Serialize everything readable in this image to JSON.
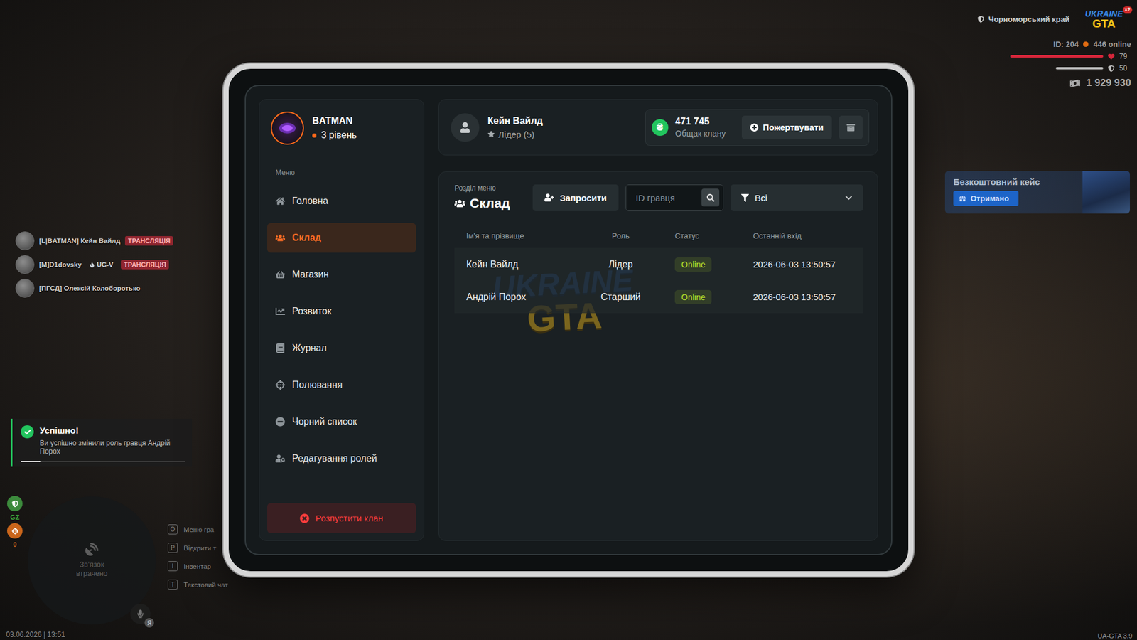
{
  "hud": {
    "region": "Чорноморський край",
    "logo": {
      "line1": "UKRAINE",
      "line2": "GTA",
      "badge": "x2"
    },
    "id": "ID: 204",
    "online": "446 online",
    "health": {
      "level": 1,
      "reading": "79"
    },
    "armor": {
      "level": 0.51,
      "reading": "50"
    },
    "money": "1 929 930"
  },
  "case_widget": {
    "title": "Безкоштовний кейс",
    "button": "Отримано"
  },
  "voice": [
    {
      "name": "[L|BATMAN] Кейн Вайлд",
      "tags": [
        {
          "text": "ТРАНСЛЯЦІЯ",
          "kind": "live"
        }
      ]
    },
    {
      "name": "[M]D1dovsky",
      "tags": [
        {
          "text": "UG-V",
          "kind": "org"
        },
        {
          "text": "ТРАНСЛЯЦІЯ",
          "kind": "live"
        }
      ]
    },
    {
      "name": "[ПГСД] Олексій Колоборотько",
      "tags": []
    }
  ],
  "notification": {
    "title": "Успішно!",
    "text": "Ви успішно змінили роль гравця Андрій Порох",
    "level": 0.12
  },
  "minimap": {
    "text": "Зв'язок втрачено",
    "zone": "GZ",
    "count": "0",
    "mic_badge": "Я"
  },
  "keys": [
    {
      "key": "O",
      "label": "Меню гра"
    },
    {
      "key": "P",
      "label": "Відкрити т"
    },
    {
      "key": "I",
      "label": "Інвентар"
    },
    {
      "key": "T",
      "label": "Текстовий чат"
    }
  ],
  "datetime": "03.06.2026 | 13:51",
  "version": "UA-GTA 3.9",
  "tablet": {
    "clan": {
      "name": "BATMAN",
      "level": "3 рівень"
    },
    "menu_label": "Меню",
    "sidebar": {
      "items": [
        {
          "label": "Головна",
          "selected": false
        },
        {
          "label": "Склад",
          "selected": true
        },
        {
          "label": "Магазин",
          "selected": false
        },
        {
          "label": "Розвиток",
          "selected": false
        },
        {
          "label": "Журнал",
          "selected": false
        },
        {
          "label": "Полювання",
          "selected": false
        },
        {
          "label": "Чорний список",
          "selected": false
        },
        {
          "label": "Редагування ролей",
          "selected": false
        }
      ]
    },
    "dissolve_button": "Розпустити клан",
    "player": {
      "name": "Кейн Вайлд",
      "rank": "Лідер (5)"
    },
    "bank": {
      "currency": "₴",
      "amount": "471 745",
      "label": "Общак клану",
      "donate": "Пожертвувати"
    },
    "section": {
      "caption": "Розділ меню",
      "title": "Склад"
    },
    "invite_button": "Запросити",
    "search": {
      "placeholder": "ID гравця"
    },
    "filter": {
      "value": "Всі"
    },
    "table": {
      "columns": [
        "Ім'я та прізвище",
        "Роль",
        "Статус",
        "Останній вхід"
      ],
      "rows": [
        {
          "name": "Кейн Вайлд",
          "role": "Лідер",
          "status": "Online",
          "color": "#b6e32b",
          "last_login": "2026-06-03 13:50:57"
        },
        {
          "name": "Андрій Порох",
          "role": "Старший",
          "status": "Online",
          "color": "#b6e32b",
          "last_login": "2026-06-03 13:50:57"
        }
      ]
    },
    "watermark": {
      "line1": "UKRAINE",
      "line2": "GTA"
    }
  }
}
